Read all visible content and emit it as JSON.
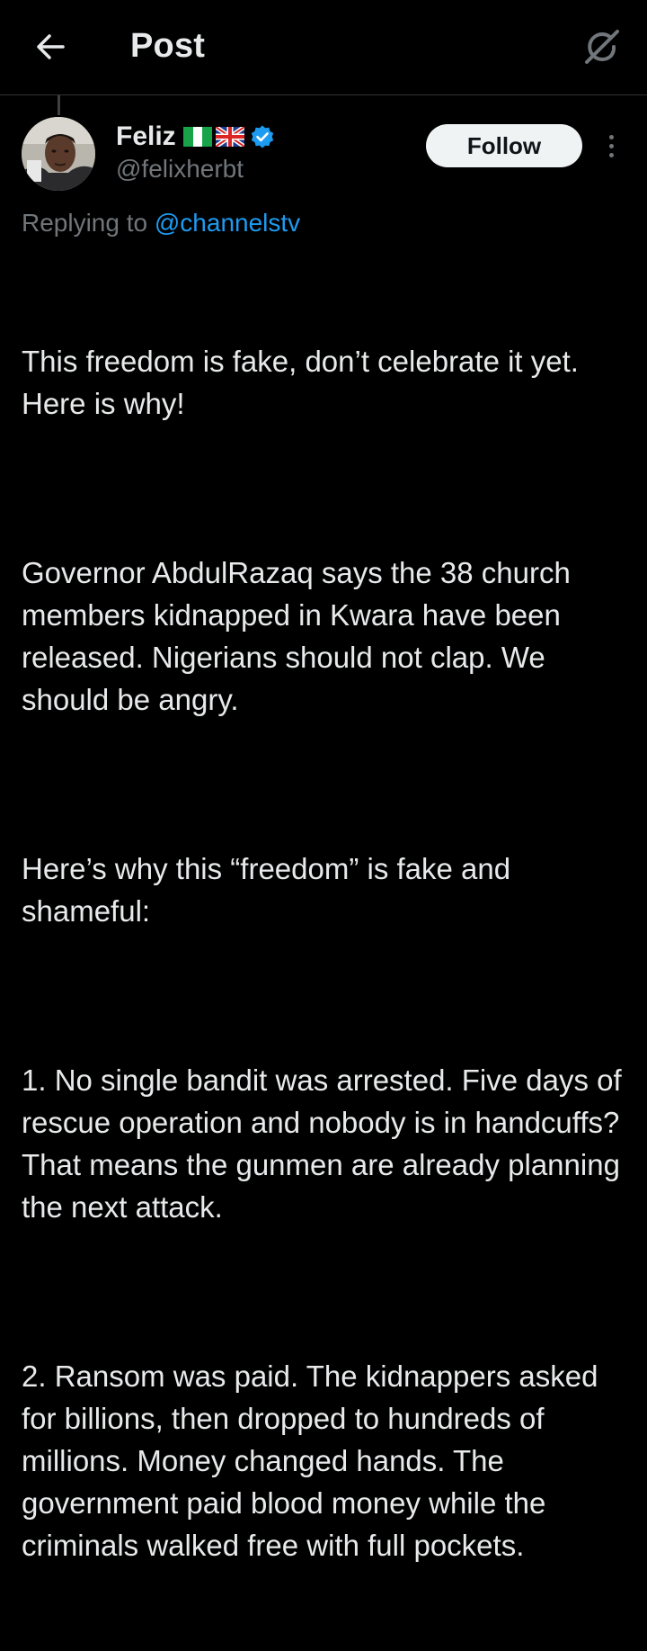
{
  "header": {
    "title": "Post",
    "back_icon": "arrow-left-icon",
    "grok_icon": "grok-icon"
  },
  "post": {
    "author": {
      "display_name": "Feliz",
      "flags": [
        "nigeria-flag",
        "uk-flag"
      ],
      "verified": true,
      "handle": "@felixherbt"
    },
    "follow_label": "Follow",
    "reply_prefix": "Replying to",
    "reply_handle": "@channelstv",
    "paragraphs": [
      "This freedom is fake, don’t celebrate it yet. Here is why!",
      "Governor AbdulRazaq says the 38 church members kidnapped in Kwara have been released. Nigerians should not clap. We should be angry.",
      "Here’s why this “freedom” is fake and shameful:",
      "1. No single bandit was arrested. Five days of rescue operation and nobody is in handcuffs? That means the gunmen are already planning the next attack.",
      "2. Ransom was paid. The kidnappers asked for billions, then dropped to hundreds of millions. Money changed hands. The government paid blood money while the criminals walked free with full pockets."
    ]
  },
  "colors": {
    "background": "#000000",
    "text": "#e7e9ea",
    "muted": "#71767b",
    "link": "#1d9bf0",
    "verified": "#1d9bf0",
    "follow_bg": "#eff3f4"
  }
}
